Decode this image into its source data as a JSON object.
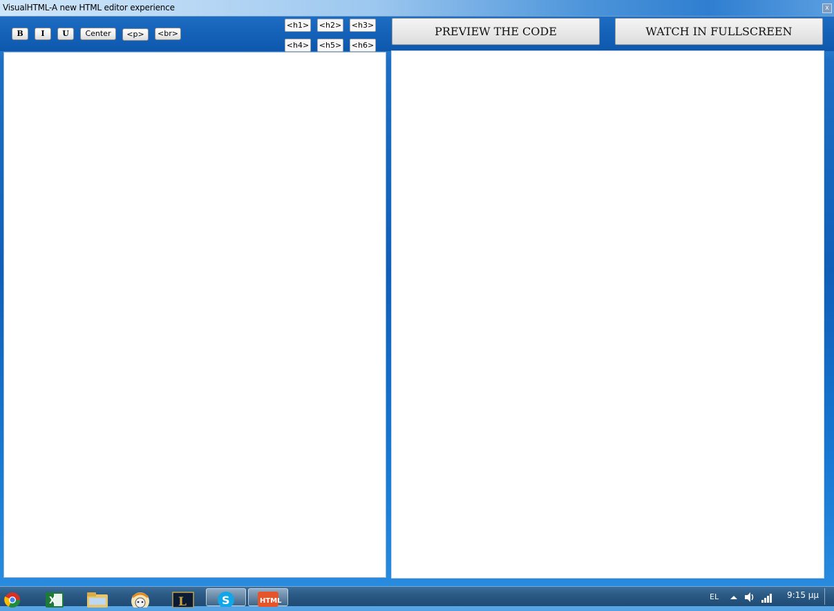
{
  "window": {
    "title": "VisualHTML-A new HTML editor experience",
    "close_label": "x"
  },
  "toolbar": {
    "bold_label": "B",
    "italic_label": "I",
    "underline_label": "U",
    "center_label": "Center",
    "p_label": "<p>",
    "br_label": "<br>",
    "headings": [
      "<h1>",
      "<h2>",
      "<h3>",
      "<h4>",
      "<h5>",
      "<h6>"
    ]
  },
  "actions": {
    "preview_label": "PREVIEW THE CODE",
    "fullscreen_label": "WATCH IN FULLSCREEN"
  },
  "editor": {
    "value": ""
  },
  "taskbar": {
    "apps": [
      "chrome-icon",
      "excel-icon",
      "file-explorer-icon",
      "sheep-icon",
      "league-icon",
      "skype-icon",
      "html-app-icon"
    ],
    "language": "EL",
    "clock_time": "9:15 μμ"
  },
  "colors": {
    "accent": "#1462b8",
    "taskbar": "#2b5a85"
  }
}
